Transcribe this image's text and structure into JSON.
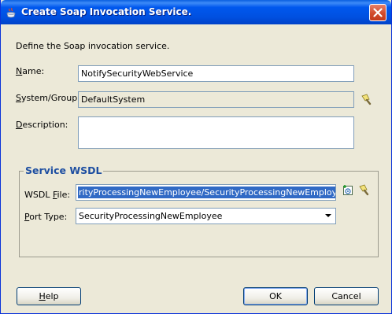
{
  "window": {
    "title": "Create Soap Invocation Service."
  },
  "form": {
    "intro": "Define the Soap invocation service.",
    "name_label": {
      "pre": "",
      "key": "N",
      "post": "ame:"
    },
    "name_value": "NotifySecurityWebService",
    "system_label": {
      "pre": "",
      "key": "S",
      "post": "ystem/Group:"
    },
    "system_value": "DefaultSystem",
    "description_label": {
      "pre": "",
      "key": "D",
      "post": "escription:"
    },
    "description_value": ""
  },
  "service_wsdl": {
    "group_title": "Service WSDL",
    "wsdl_label": {
      "pre": "WSDL ",
      "key": "F",
      "post": "ile:"
    },
    "wsdl_value": "rityProcessingNewEmployee/SecurityProcessingNewEmployee?wsdl",
    "port_label": {
      "pre": "",
      "key": "P",
      "post": "ort Type:"
    },
    "port_value": "SecurityProcessingNewEmployee"
  },
  "buttons": {
    "help": {
      "pre": "",
      "key": "H",
      "post": "elp"
    },
    "ok": "OK",
    "cancel": "Cancel"
  },
  "icons": {
    "title": "coffee-cup-icon",
    "system_browse": "flashlight-icon",
    "wsdl_create": "add-wsdl-icon",
    "wsdl_browse": "flashlight-icon",
    "close": "close-icon",
    "combo": "chevron-down-icon"
  },
  "colors": {
    "titlebar": "#0058ee",
    "face": "#ece9d8",
    "group_title": "#1d4ea1",
    "selection": "#316ac5",
    "close": "#d14b2c"
  }
}
